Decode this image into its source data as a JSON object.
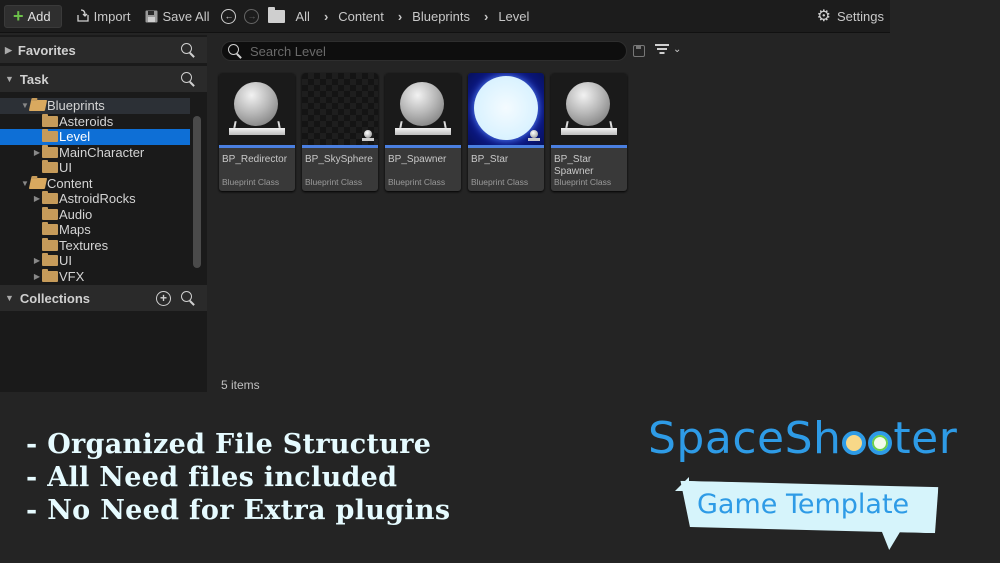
{
  "toolbar": {
    "add_label": "Add",
    "import_label": "Import",
    "save_all_label": "Save All",
    "breadcrumbs": [
      "All",
      "Content",
      "Blueprints",
      "Level"
    ],
    "settings_label": "Settings"
  },
  "sidebar": {
    "favorites_label": "Favorites",
    "task_label": "Task",
    "collections_label": "Collections",
    "tree": [
      {
        "label": "Blueprints",
        "depth": 1,
        "expanded": true
      },
      {
        "label": "Asteroids",
        "depth": 2
      },
      {
        "label": "Level",
        "depth": 2,
        "selected": true
      },
      {
        "label": "MainCharacter",
        "depth": 2,
        "has_children": true
      },
      {
        "label": "UI",
        "depth": 2
      },
      {
        "label": "Content",
        "depth": 1,
        "expanded": true
      },
      {
        "label": "AstroidRocks",
        "depth": 2,
        "has_children": true
      },
      {
        "label": "Audio",
        "depth": 2
      },
      {
        "label": "Maps",
        "depth": 2
      },
      {
        "label": "Textures",
        "depth": 2
      },
      {
        "label": "UI",
        "depth": 2,
        "has_children": true
      },
      {
        "label": "VFX",
        "depth": 2,
        "has_children": true
      }
    ]
  },
  "content": {
    "search_placeholder": "Search Level",
    "search_value": "",
    "assets": [
      {
        "name": "BP_Redirector",
        "type": "Blueprint Class",
        "thumb": "sphere"
      },
      {
        "name": "BP_SkySphere",
        "type": "Blueprint Class",
        "thumb": "checker"
      },
      {
        "name": "BP_Spawner",
        "type": "Blueprint Class",
        "thumb": "sphere"
      },
      {
        "name": "BP_Star",
        "type": "Blueprint Class",
        "thumb": "star"
      },
      {
        "name": "BP_Star Spawner",
        "type": "Blueprint Class",
        "thumb": "sphere"
      }
    ],
    "item_count": "5 items"
  },
  "promo": {
    "features": [
      "- Organized File Structure",
      "- All Need files included",
      "- No Need for Extra plugins"
    ],
    "brand_part1": "SpaceSh",
    "brand_part2": "ter",
    "badge": "Game Template",
    "colors": {
      "brand": "#2e9be6",
      "feature_text": "#e6fbff",
      "badge_bg": "#d6f4fb",
      "selection": "#0e6fd6",
      "asset_bar": "#4a7fe0"
    }
  }
}
